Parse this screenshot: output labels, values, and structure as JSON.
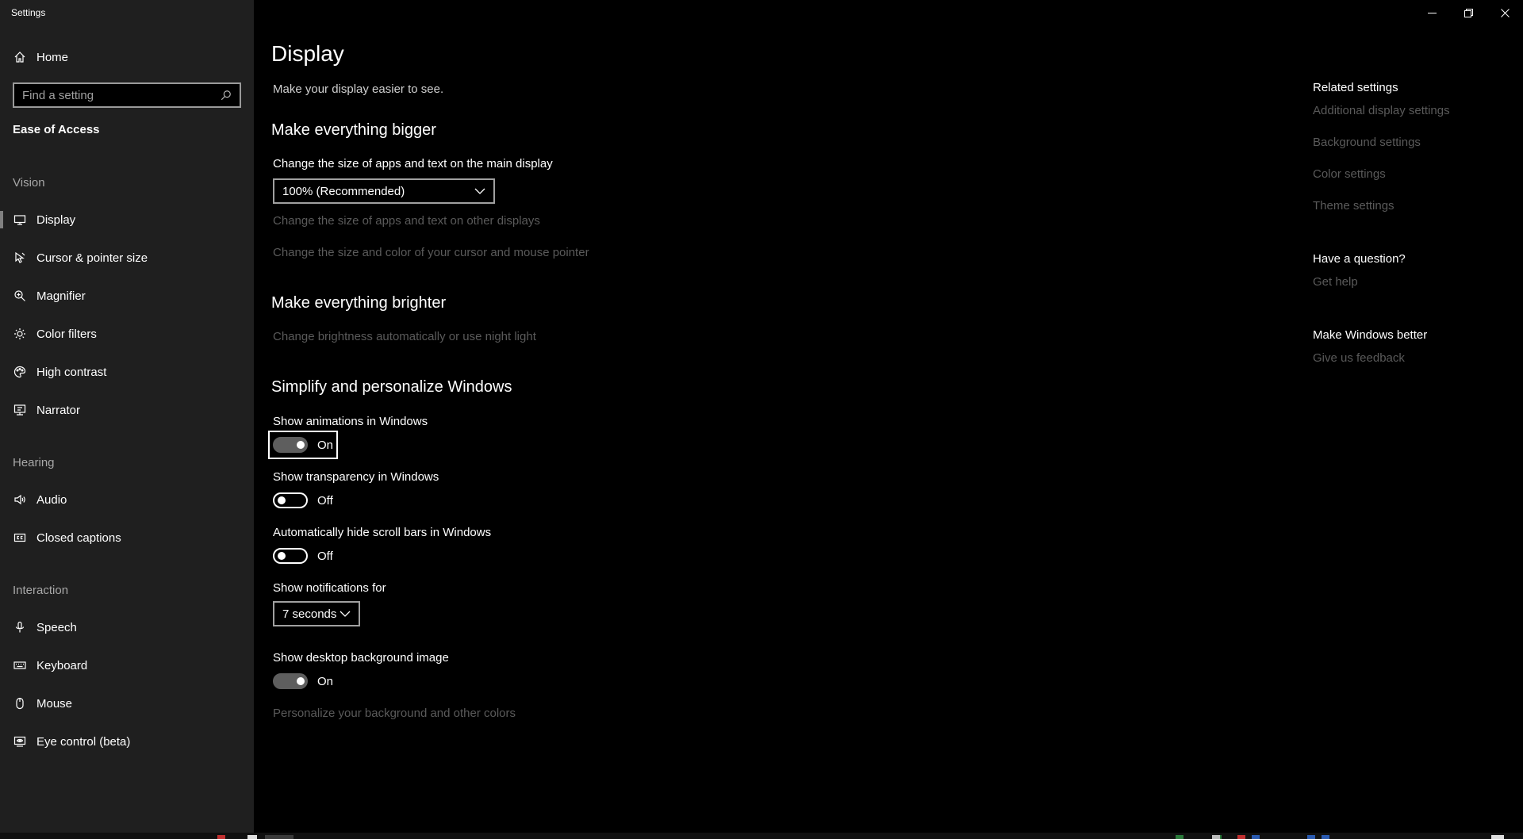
{
  "window": {
    "title": "Settings"
  },
  "sidebar": {
    "home_label": "Home",
    "search_placeholder": "Find a setting",
    "section_title": "Ease of Access",
    "groups": {
      "vision": "Vision",
      "hearing": "Hearing",
      "interaction": "Interaction"
    },
    "items": {
      "display": "Display",
      "cursor": "Cursor & pointer size",
      "magnifier": "Magnifier",
      "color_filters": "Color filters",
      "high_contrast": "High contrast",
      "narrator": "Narrator",
      "audio": "Audio",
      "closed_captions": "Closed captions",
      "speech": "Speech",
      "keyboard": "Keyboard",
      "mouse": "Mouse",
      "eye_control": "Eye control (beta)"
    },
    "selected_item": "Display"
  },
  "main": {
    "title": "Display",
    "subtitle": "Make your display easier to see.",
    "bigger": {
      "heading": "Make everything bigger",
      "scale_label": "Change the size of apps and text on the main display",
      "scale_value": "100% (Recommended)",
      "other_displays_link": "Change the size of apps and text on other displays",
      "cursor_link": "Change the size and color of your cursor and mouse pointer"
    },
    "brighter": {
      "heading": "Make everything brighter",
      "brightness_link": "Change brightness automatically or use night light"
    },
    "simplify": {
      "heading": "Simplify and personalize Windows",
      "animations_label": "Show animations in Windows",
      "animations_state": "On",
      "transparency_label": "Show transparency in Windows",
      "transparency_state": "Off",
      "scrollbars_label": "Automatically hide scroll bars in Windows",
      "scrollbars_state": "Off",
      "notifications_label": "Show notifications for",
      "notifications_value": "7 seconds",
      "background_label": "Show desktop background image",
      "background_state": "On",
      "personalize_link": "Personalize your background and other colors"
    }
  },
  "related": {
    "heading": "Related settings",
    "links": {
      "additional_display": "Additional display settings",
      "background": "Background settings",
      "color": "Color settings",
      "theme": "Theme settings"
    },
    "question_heading": "Have a question?",
    "get_help": "Get help",
    "better_heading": "Make Windows better",
    "feedback": "Give us feedback"
  },
  "icons": {
    "home": "home-icon",
    "search": "search-icon",
    "display": "monitor-icon",
    "cursor": "cursor-icon",
    "magnifier": "magnifier-icon",
    "color_filters": "sun-icon",
    "high_contrast": "palette-icon",
    "narrator": "narrator-icon",
    "audio": "speaker-icon",
    "closed_captions": "cc-icon",
    "speech": "microphone-icon",
    "keyboard": "keyboard-icon",
    "mouse": "mouse-icon",
    "eye_control": "eye-control-icon"
  },
  "colors": {
    "sidebar_bg": "#1f1f1f",
    "content_bg": "#000000",
    "disabled_text": "#5a5a5a",
    "toggle_on": "#5e5e5e"
  }
}
